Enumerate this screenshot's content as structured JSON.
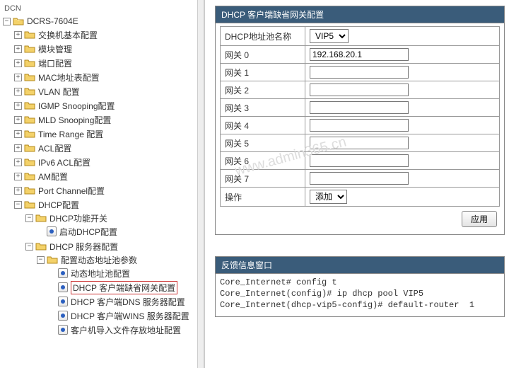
{
  "tree": {
    "root_label": "DCN",
    "device": "DCRS-7604E",
    "items": [
      "交换机基本配置",
      "模块管理",
      "端口配置",
      "MAC地址表配置",
      "VLAN 配置",
      "IGMP Snooping配置",
      "MLD Snooping配置",
      "Time Range 配置",
      "ACL配置",
      "IPv6 ACL配置",
      "AM配置",
      "Port Channel配置"
    ],
    "dhcp": {
      "label": "DHCP配置",
      "switch": {
        "label": "DHCP功能开关",
        "child": "启动DHCP配置"
      },
      "server": {
        "label": "DHCP 服务器配置",
        "pool_params": "配置动态地址池参数",
        "children": [
          "动态地址池配置",
          "DHCP 客户端缺省网关配置",
          "DHCP 客户端DNS 服务器配置",
          "DHCP 客户端WINS 服务器配置",
          "客户机导入文件存放地址配置"
        ]
      }
    }
  },
  "form": {
    "title": "DHCP 客户端缺省网关配置",
    "pool_label": "DHCP地址池名称",
    "pool_value": "VIP5",
    "gateways": [
      {
        "label": "网关  0",
        "value": "192.168.20.1"
      },
      {
        "label": "网关  1",
        "value": ""
      },
      {
        "label": "网关  2",
        "value": ""
      },
      {
        "label": "网关  3",
        "value": ""
      },
      {
        "label": "网关  4",
        "value": ""
      },
      {
        "label": "网关  5",
        "value": ""
      },
      {
        "label": "网关  6",
        "value": ""
      },
      {
        "label": "网关  7",
        "value": ""
      }
    ],
    "action_label": "操作",
    "action_value": "添加",
    "apply": "应用"
  },
  "feedback": {
    "title": "反馈信息窗口",
    "lines": [
      "Core_Internet# config t",
      "Core_Internet(config)# ip dhcp pool VIP5",
      "Core_Internet(dhcp-vip5-config)# default-router  1"
    ]
  },
  "watermark": "www.admin365.cn"
}
